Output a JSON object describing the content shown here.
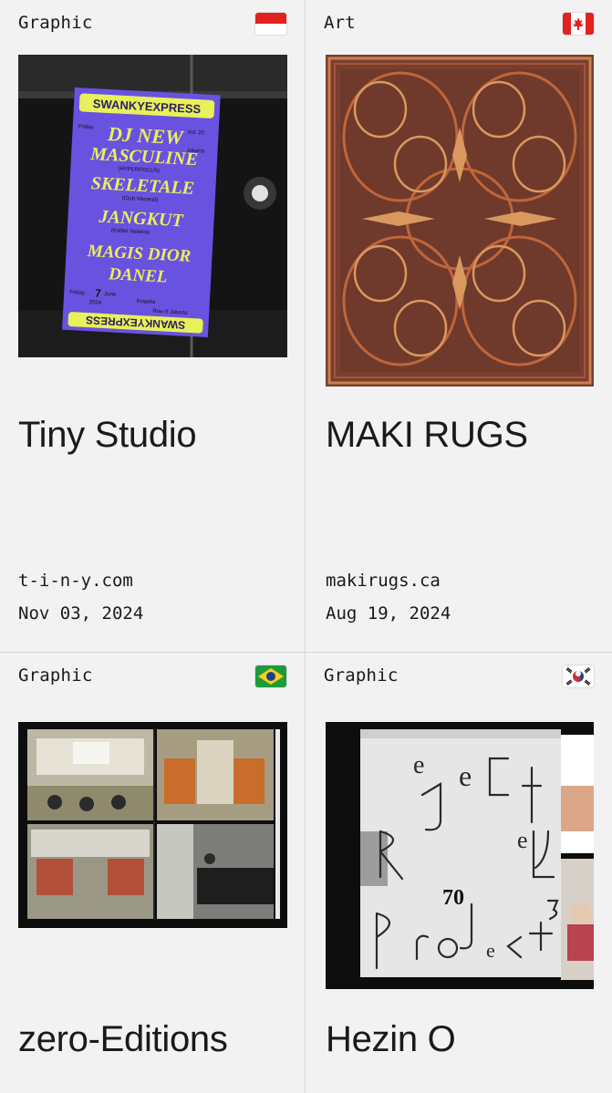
{
  "cards": [
    {
      "category": "Graphic",
      "flag": "indonesia-flag",
      "image": "poster-in-window",
      "title": "Tiny Studio",
      "site": "t-i-n-y.com",
      "date": "Nov 03, 2024",
      "poster": {
        "head": "SWANKYEXPRESS",
        "line1": "DJ NEW",
        "line2": "MASCULINE",
        "line3": "SKELETALE",
        "line4": "JANGKUT",
        "line5": "MAGIS DIOR",
        "line6": "DANEL",
        "vol": "Vol. 20",
        "city": "Jakarta",
        "day": "Friday",
        "num": "7",
        "month": "June",
        "year": "2024",
        "venue": "Krapela",
        "row": "Row 9 Jakarta",
        "focus": "(HYPERFOCUS)",
        "club": "(Club Visceral)",
        "kolibri": "(Kolibri Selekta)"
      }
    },
    {
      "category": "Art",
      "flag": "canada-flag",
      "image": "rug-pattern",
      "title": "MAKI RUGS",
      "site": "makirugs.ca",
      "date": "Aug 19, 2024"
    },
    {
      "category": "Graphic",
      "flag": "brazil-flag",
      "image": "book-spread-photos",
      "title": "zero-Editions"
    },
    {
      "category": "Graphic",
      "flag": "south-korea-flag",
      "image": "rejected-projects-book",
      "title": "Hezin O",
      "book": {
        "number": "70"
      }
    }
  ],
  "colors": {
    "background": "#f2f2f2",
    "divider": "#d6d6d6",
    "text": "#1a1a1a"
  }
}
